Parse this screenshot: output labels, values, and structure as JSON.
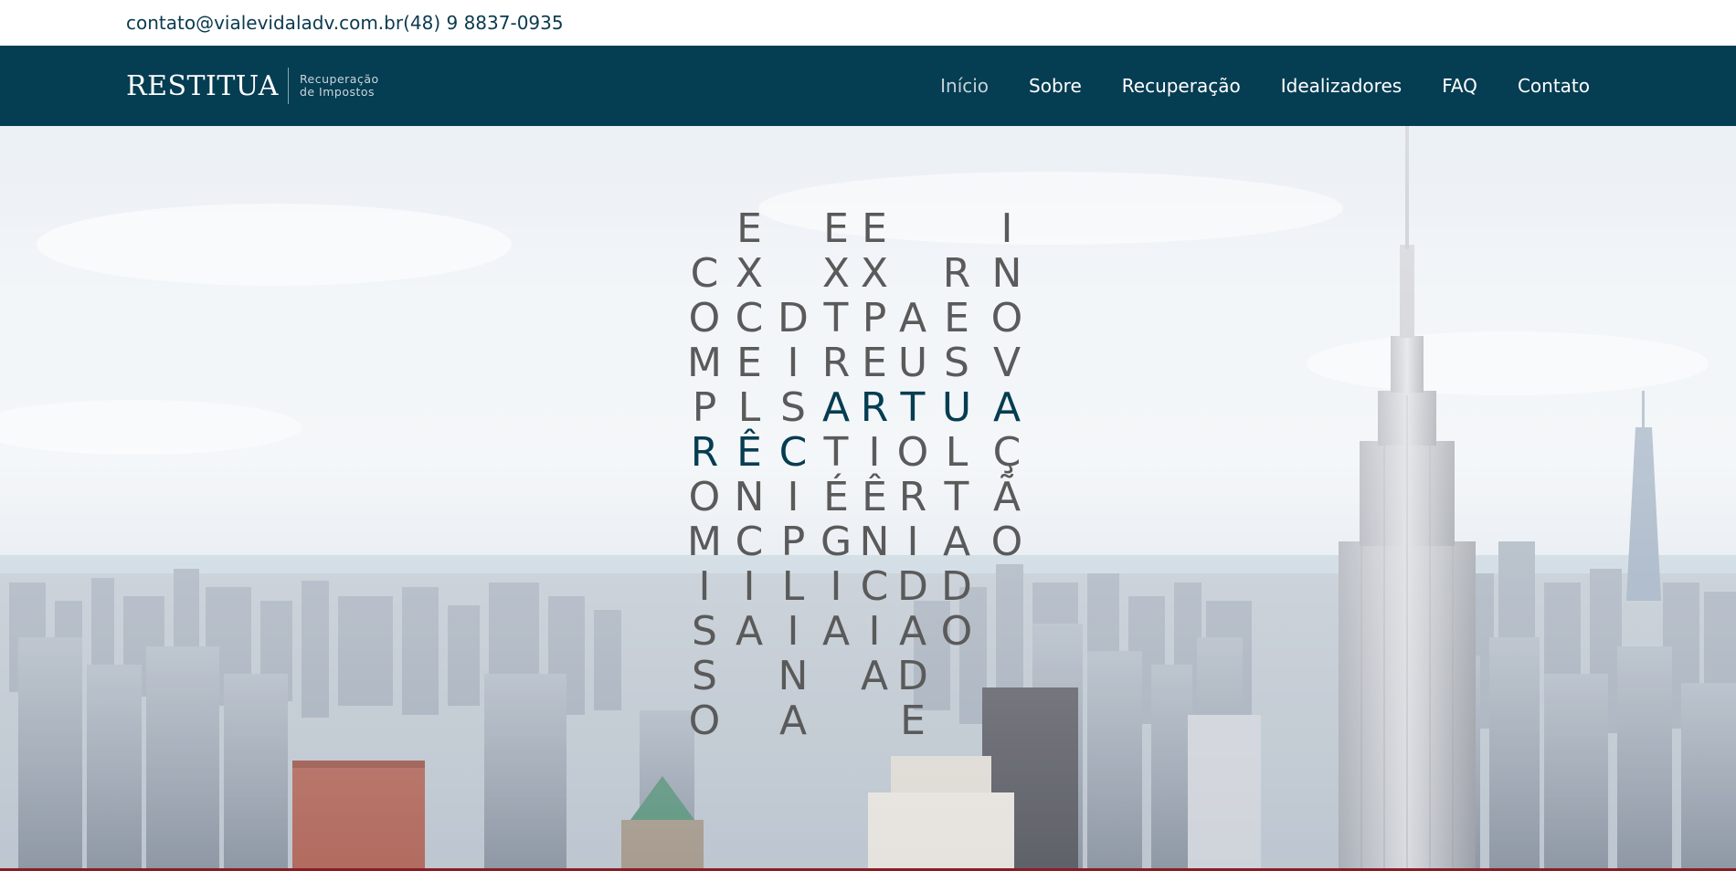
{
  "topbar": {
    "email": "contato@vialevidaladv.com.br",
    "phone": "(48) 9 8837-0935"
  },
  "brand": {
    "name": "RESTITUA",
    "tagline_1": "Recuperação",
    "tagline_2": "de Impostos"
  },
  "nav": {
    "items": [
      "Início",
      "Sobre",
      "Recuperação",
      "Idealizadores",
      "FAQ",
      "Contato"
    ],
    "active": "Início"
  },
  "hero": {
    "highlight_word": "RESTITUA",
    "columns": [
      [
        "C",
        "O",
        "M",
        "P",
        "R",
        "O",
        "M",
        "I",
        "S",
        "S",
        "O"
      ],
      [
        "E",
        "X",
        "C",
        "E",
        "L",
        "Ê",
        "N",
        "C",
        "I",
        "A"
      ],
      [
        "D",
        "I",
        "S",
        "C",
        "I",
        "P",
        "L",
        "I",
        "N",
        "A"
      ],
      [
        "E",
        "X",
        "T",
        "R",
        "A",
        "T",
        "É",
        "G",
        "I",
        "A"
      ],
      [
        "E",
        "X",
        "P",
        "E",
        "R",
        "I",
        "Ê",
        "N",
        "C",
        "I",
        "A"
      ],
      [
        "A",
        "U",
        "T",
        "O",
        "R",
        "I",
        "D",
        "A",
        "D",
        "E"
      ],
      [
        "R",
        "E",
        "S",
        "U",
        "L",
        "T",
        "A",
        "D",
        "O"
      ],
      [
        "I",
        "N",
        "O",
        "V",
        "A",
        "Ç",
        "Ã",
        "O"
      ]
    ],
    "colors": {
      "letters": "#5a5a5a",
      "highlight": "#053d52"
    }
  },
  "colors": {
    "navbar": "#053d52",
    "contact_text": "#0b3a4f",
    "accent_line": "#8a1c24"
  }
}
